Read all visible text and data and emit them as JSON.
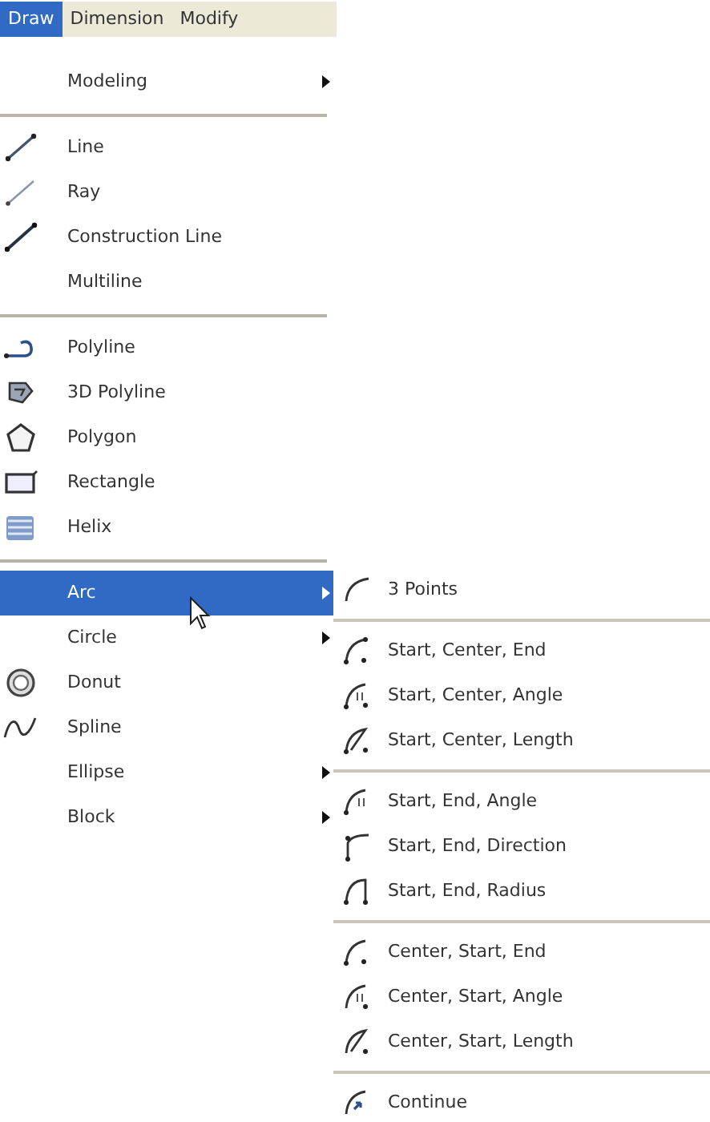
{
  "menubar": [
    {
      "label": "Draw",
      "selected": true
    },
    {
      "label": "Dimension",
      "selected": false
    },
    {
      "label": "Modify",
      "selected": false
    }
  ],
  "menu": [
    {
      "kind": "item",
      "label": "Modeling",
      "submenu": true,
      "selected": false
    },
    {
      "kind": "separator"
    },
    {
      "kind": "item",
      "label": "Line",
      "submenu": false,
      "selected": false
    },
    {
      "kind": "item",
      "label": "Ray",
      "submenu": false,
      "selected": false
    },
    {
      "kind": "item",
      "label": "Construction Line",
      "submenu": false,
      "selected": false
    },
    {
      "kind": "item",
      "label": "Multiline",
      "submenu": false,
      "selected": false
    },
    {
      "kind": "separator"
    },
    {
      "kind": "item",
      "label": "Polyline",
      "submenu": false,
      "selected": false
    },
    {
      "kind": "item",
      "label": "3D Polyline",
      "submenu": false,
      "selected": false
    },
    {
      "kind": "item",
      "label": "Polygon",
      "submenu": false,
      "selected": false
    },
    {
      "kind": "item",
      "label": "Rectangle",
      "submenu": false,
      "selected": false
    },
    {
      "kind": "item",
      "label": "Helix",
      "submenu": false,
      "selected": false
    },
    {
      "kind": "separator"
    },
    {
      "kind": "item",
      "label": "Arc",
      "submenu": true,
      "selected": true
    },
    {
      "kind": "item",
      "label": "Circle",
      "submenu": true,
      "selected": false
    },
    {
      "kind": "item",
      "label": "Donut",
      "submenu": false,
      "selected": false
    },
    {
      "kind": "item",
      "label": "Spline",
      "submenu": false,
      "selected": false
    },
    {
      "kind": "item",
      "label": "Ellipse",
      "submenu": true,
      "selected": false
    },
    {
      "kind": "item",
      "label": "Block",
      "submenu": true,
      "selected": false
    }
  ],
  "submenu": [
    {
      "kind": "item",
      "label": "3 Points"
    },
    {
      "kind": "separator"
    },
    {
      "kind": "item",
      "label": "Start, Center, End"
    },
    {
      "kind": "item",
      "label": "Start, Center, Angle"
    },
    {
      "kind": "item",
      "label": "Start, Center, Length"
    },
    {
      "kind": "separator"
    },
    {
      "kind": "item",
      "label": "Start, End, Angle"
    },
    {
      "kind": "item",
      "label": "Start, End, Direction"
    },
    {
      "kind": "item",
      "label": "Start, End, Radius"
    },
    {
      "kind": "separator"
    },
    {
      "kind": "item",
      "label": "Center, Start, End"
    },
    {
      "kind": "item",
      "label": "Center, Start, Angle"
    },
    {
      "kind": "item",
      "label": "Center, Start, Length"
    },
    {
      "kind": "separator"
    },
    {
      "kind": "item",
      "label": "Continue"
    }
  ]
}
